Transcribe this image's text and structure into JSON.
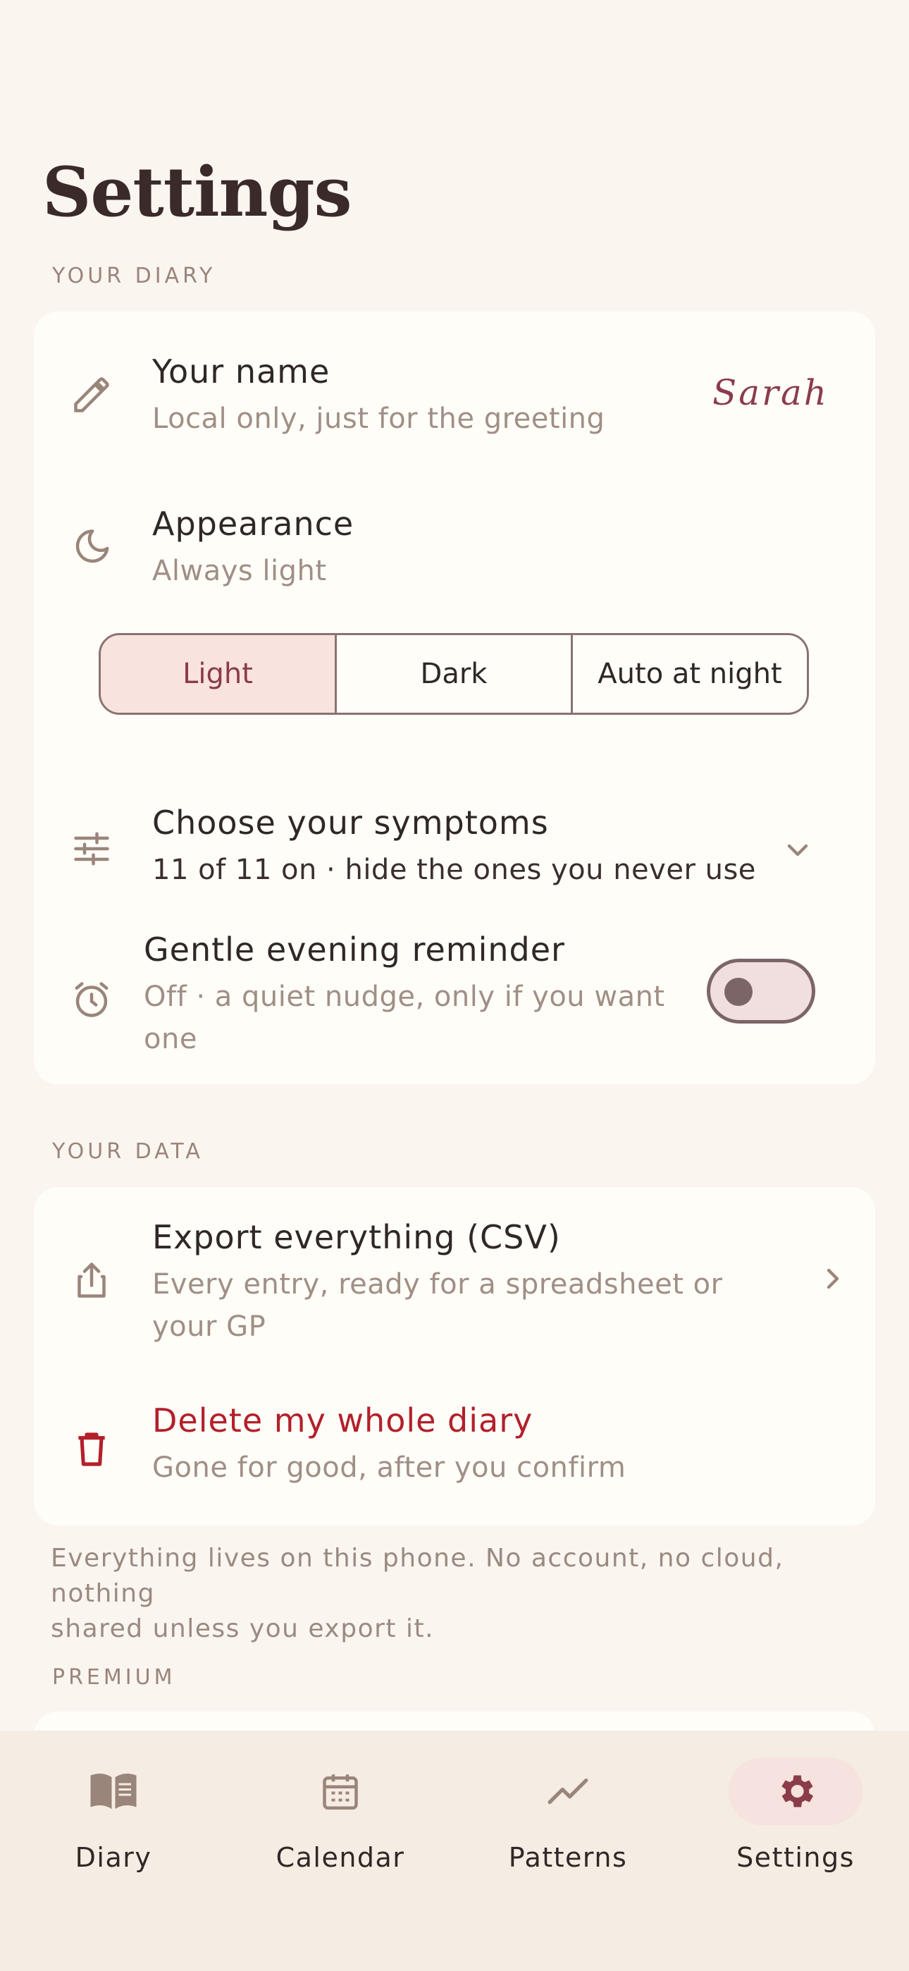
{
  "header": {
    "title": "Settings"
  },
  "sections": {
    "diary": {
      "label": "YOUR DIARY"
    },
    "data": {
      "label": "YOUR DATA"
    },
    "premium": {
      "label": "PREMIUM"
    }
  },
  "diary": {
    "name": {
      "title": "Your name",
      "subtitle": "Local only, just for the greeting",
      "value": "Sarah",
      "icon": "pencil-icon"
    },
    "appearance": {
      "title": "Appearance",
      "subtitle": "Always light",
      "icon": "moon-icon",
      "options": [
        "Light",
        "Dark",
        "Auto at night"
      ],
      "selected": "Light"
    },
    "symptoms": {
      "title": "Choose your symptoms",
      "subtitle": "11 of 11 on · hide the ones you never use",
      "icon": "sliders-icon"
    },
    "reminder": {
      "title": "Gentle evening reminder",
      "subtitle_line1": "Off · a quiet nudge, only if you want",
      "subtitle_line2": "one",
      "icon": "alarm-icon",
      "enabled": false
    }
  },
  "data": {
    "export": {
      "title": "Export everything (CSV)",
      "subtitle_line1": "Every entry, ready for a spreadsheet or",
      "subtitle_line2": "your GP",
      "icon": "share-icon"
    },
    "delete": {
      "title": "Delete my whole diary",
      "subtitle": "Gone for good, after you confirm",
      "icon": "trash-icon"
    }
  },
  "note": {
    "line1": "Everything lives on this phone. No account, no cloud, nothing",
    "line2": "shared unless you export it."
  },
  "nav": {
    "items": [
      {
        "label": "Diary",
        "icon": "book-icon"
      },
      {
        "label": "Calendar",
        "icon": "calendar-icon"
      },
      {
        "label": "Patterns",
        "icon": "trend-icon"
      },
      {
        "label": "Settings",
        "icon": "gear-icon"
      }
    ],
    "active": "Settings"
  },
  "colors": {
    "accent": "#8a3c4a",
    "danger": "#b3202a",
    "background": "#faf5ef",
    "card": "#fffdf8",
    "nav": "#f5ece3"
  }
}
